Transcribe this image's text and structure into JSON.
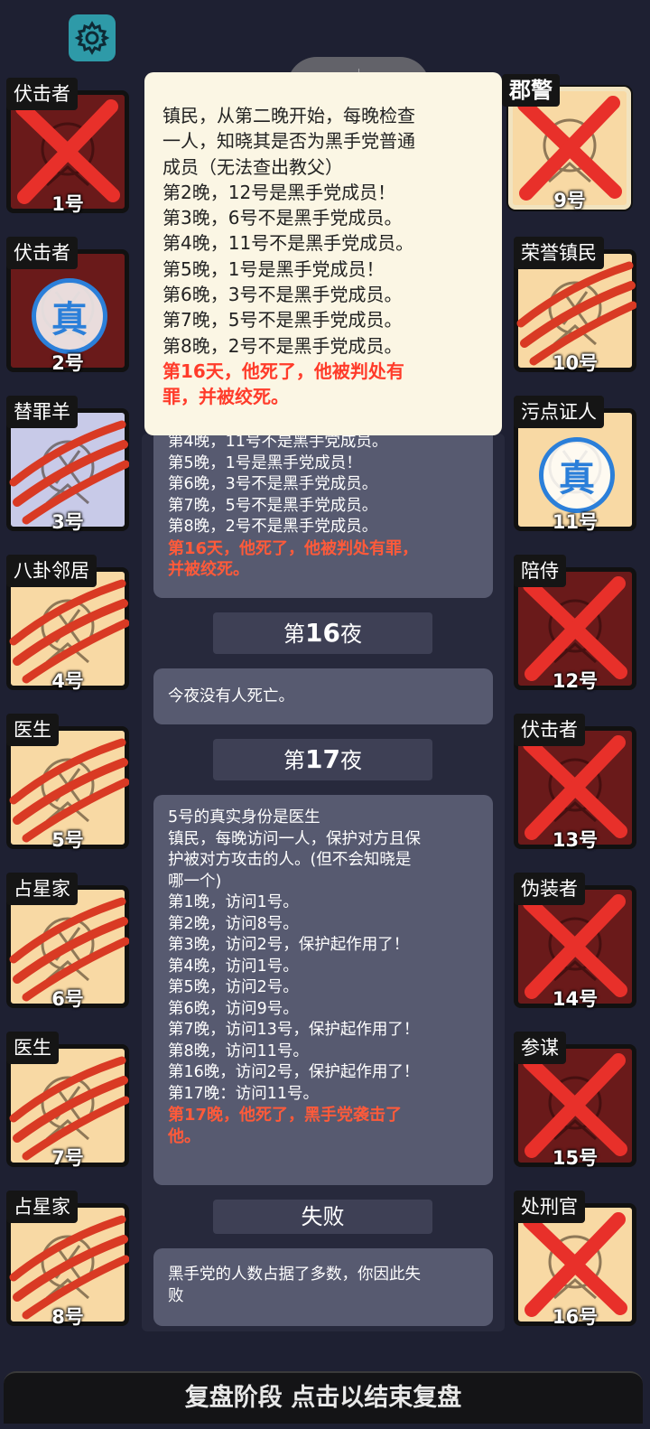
{
  "settings": {
    "icon": "gear-icon"
  },
  "capsule": {
    "icons": [
      "more-dots-icon",
      "close-target-icon"
    ]
  },
  "cards": [
    {
      "id": "c1",
      "role": "伏击者",
      "num": "1号",
      "theme": "dark",
      "status": "x"
    },
    {
      "id": "c2",
      "role": "伏击者",
      "num": "2号",
      "theme": "dark",
      "status": "real",
      "stamp": "真"
    },
    {
      "id": "c3",
      "role": "替罪羊",
      "num": "3号",
      "theme": "purple",
      "status": "claw"
    },
    {
      "id": "c4",
      "role": "八卦邻居",
      "num": "4号",
      "theme": "light",
      "status": "claw"
    },
    {
      "id": "c5",
      "role": "医生",
      "num": "5号",
      "theme": "light",
      "status": "claw"
    },
    {
      "id": "c6",
      "role": "占星家",
      "num": "6号",
      "theme": "light",
      "status": "claw"
    },
    {
      "id": "c7",
      "role": "医生",
      "num": "7号",
      "theme": "light",
      "status": "claw"
    },
    {
      "id": "c8",
      "role": "占星家",
      "num": "8号",
      "theme": "light",
      "status": "claw"
    },
    {
      "id": "c9",
      "role": "郡警",
      "num": "9号",
      "theme": "light",
      "status": "x",
      "highlight": true
    },
    {
      "id": "c10",
      "role": "荣誉镇民",
      "num": "10号",
      "theme": "light",
      "status": "claw"
    },
    {
      "id": "c11",
      "role": "污点证人",
      "num": "11号",
      "theme": "light",
      "status": "real",
      "stamp": "真"
    },
    {
      "id": "c12",
      "role": "陪侍",
      "num": "12号",
      "theme": "dark",
      "status": "x"
    },
    {
      "id": "c13",
      "role": "伏击者",
      "num": "13号",
      "theme": "dark",
      "status": "x"
    },
    {
      "id": "c14",
      "role": "伪装者",
      "num": "14号",
      "theme": "dark",
      "status": "x"
    },
    {
      "id": "c15",
      "role": "参谋",
      "num": "15号",
      "theme": "dark",
      "status": "x"
    },
    {
      "id": "c16",
      "role": "处刑官",
      "num": "16号",
      "theme": "light",
      "status": "x"
    }
  ],
  "popup": {
    "lines": [
      {
        "text": "镇民，从第二晚开始，每晚检查",
        "red": false
      },
      {
        "text": "一人，知晓其是否为黑手党普通",
        "red": false
      },
      {
        "text": "成员（无法查出教父）",
        "red": false
      },
      {
        "text": "第2晚，12号是黑手党成员！",
        "red": false
      },
      {
        "text": "第3晚，6号不是黑手党成员。",
        "red": false
      },
      {
        "text": "第4晚，11号不是黑手党成员。",
        "red": false
      },
      {
        "text": "第5晚，1号是黑手党成员！",
        "red": false
      },
      {
        "text": "第6晚，3号不是黑手党成员。",
        "red": false
      },
      {
        "text": "第7晚，5号不是黑手党成员。",
        "red": false
      },
      {
        "text": "第8晚，2号不是黑手党成员。",
        "red": false
      },
      {
        "text": "第16天，他死了，他被判处有",
        "red": true
      },
      {
        "text": "罪，并被绞死。",
        "red": true
      }
    ]
  },
  "log": {
    "msg_top_lines": [
      {
        "text": "第4晚，11号不是黑手党成员。",
        "red": false
      },
      {
        "text": "第5晚，1号是黑手党成员！",
        "red": false
      },
      {
        "text": "第6晚，3号不是黑手党成员。",
        "red": false
      },
      {
        "text": "第7晚，5号不是黑手党成员。",
        "red": false
      },
      {
        "text": "第8晚，2号不是黑手党成员。",
        "red": false
      },
      {
        "text": "第16天，他死了，他被判处有罪，",
        "red": true
      },
      {
        "text": "并被绞死。",
        "red": true
      }
    ],
    "night16": {
      "prefix": "第",
      "num": "16",
      "suffix": "夜"
    },
    "night16_msg": "今夜没有人死亡。",
    "night17": {
      "prefix": "第",
      "num": "17",
      "suffix": "夜"
    },
    "night17_lines": [
      {
        "text": "5号的真实身份是医生",
        "red": false
      },
      {
        "text": "镇民，每晚访问一人，保护对方且保",
        "red": false
      },
      {
        "text": "护被对方攻击的人。(但不会知晓是",
        "red": false
      },
      {
        "text": "哪一个)",
        "red": false
      },
      {
        "text": "第1晚，访问1号。",
        "red": false
      },
      {
        "text": "第2晚，访问8号。",
        "red": false
      },
      {
        "text": "第3晚，访问2号，保护起作用了！",
        "red": false
      },
      {
        "text": "第4晚，访问1号。",
        "red": false
      },
      {
        "text": "第5晚，访问2号。",
        "red": false
      },
      {
        "text": "第6晚，访问9号。",
        "red": false
      },
      {
        "text": "第7晚，访问13号，保护起作用了！",
        "red": false
      },
      {
        "text": "第8晚，访问11号。",
        "red": false
      },
      {
        "text": "第16晚，访问2号，保护起作用了！",
        "red": false
      },
      {
        "text": "第17晚：访问11号。",
        "red": false
      },
      {
        "text": "第17晚，他死了，黑手党袭击了",
        "red": true
      },
      {
        "text": "他。",
        "red": true
      }
    ],
    "fail_header": "失败",
    "fail_lines": [
      {
        "text": "黑手党的人数占据了多数，你因此失",
        "red": false
      },
      {
        "text": "败",
        "red": false
      }
    ]
  },
  "bottom_bar": {
    "label": "复盘阶段 点击以结束复盘"
  },
  "colors": {
    "x": "#e8302a",
    "claw": "#d93a24",
    "stamp": "#2b7fd9",
    "popup_bg": "#fbf6e4"
  }
}
